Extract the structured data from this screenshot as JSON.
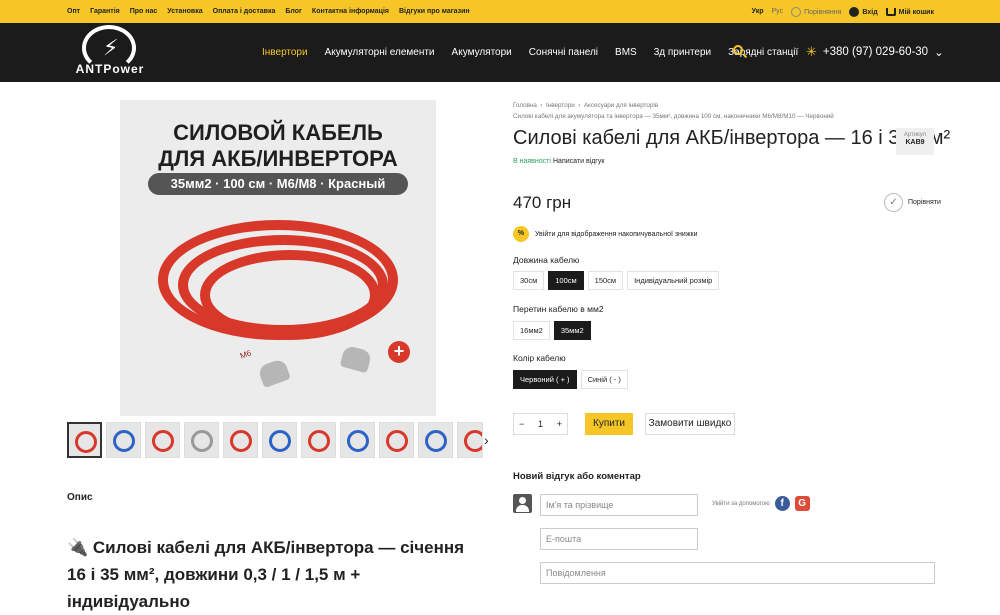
{
  "topbar": {
    "links": [
      "Опт",
      "Гарантія",
      "Про нас",
      "Установка",
      "Оплата і доставка",
      "Блог",
      "Контактна інформація",
      "Відгуки про магазин"
    ],
    "lang_ua": "Укр",
    "lang_ru": "Рус",
    "compare": "Порівняння",
    "login": "Вхід",
    "cart": "Мій кошик"
  },
  "header": {
    "logo_text": "ANTPower",
    "nav": [
      "Інвертори",
      "Акумуляторні елементи",
      "Акумулятори",
      "Сонячні панелі",
      "BMS",
      "3д принтери",
      "Зарядні станції"
    ],
    "active_nav": "Інвертори",
    "phone": "+380 (97) 029-60-30"
  },
  "image": {
    "title_line1": "СИЛОВОЙ КАБЕЛЬ",
    "title_line2": "ДЛЯ АКБ/ИНВЕРТОРА",
    "spec_pill": "35мм2 · 100 см · М6/М8 · Красный",
    "lug_text": "M6"
  },
  "product": {
    "breadcrumb": [
      "Головна",
      "Інвертори",
      "Аксесуари для інверторів"
    ],
    "breadcrumb_current": "Силові кабелі для акумулятора та інвертора — 35мм², довжина 100 см, наконечники M6/M8/M10 — Червоний",
    "title": "Силові кабелі для АКБ/інвертора — 16 і 35 мм²",
    "sku_label": "Артикул",
    "sku": "KAB9",
    "in_stock": "В наявності",
    "write_review": "Написати відгук",
    "price": "470 грн",
    "compare": "Порівняти",
    "login_discount": "Увійти для відображення накопичувальної знижки",
    "length_label": "Довжина кабелю",
    "lengths": [
      "30см",
      "100см",
      "150см",
      "Індивідуальний розмір"
    ],
    "section_label": "Перетин кабелю в мм2",
    "sections": [
      "16мм2",
      "35мм2"
    ],
    "color_label": "Колір кабелю",
    "colors": [
      "Червоний ( + )",
      "Синій ( - )"
    ],
    "qty": "1",
    "buy": "Купити",
    "quick_order": "Замовити швидко"
  },
  "description": {
    "heading": "Опис",
    "intro": "🔌 Силові кабелі для АКБ/інвертора — січення 16 і 35 мм², довжини 0,3 / 1 / 1,5 м + індивідуально"
  },
  "review_form": {
    "title": "Новий відгук або коментар",
    "name_placeholder": "Ім'я та прізвище",
    "email_placeholder": "Е-пошта",
    "message_placeholder": "Повідомлення",
    "social_login": "Увійти за допомогою"
  },
  "colors": {
    "accent": "#f6c627",
    "header_bg": "#1b1b1b",
    "in_stock": "#2aa05a",
    "cable_red": "#d8382a"
  }
}
